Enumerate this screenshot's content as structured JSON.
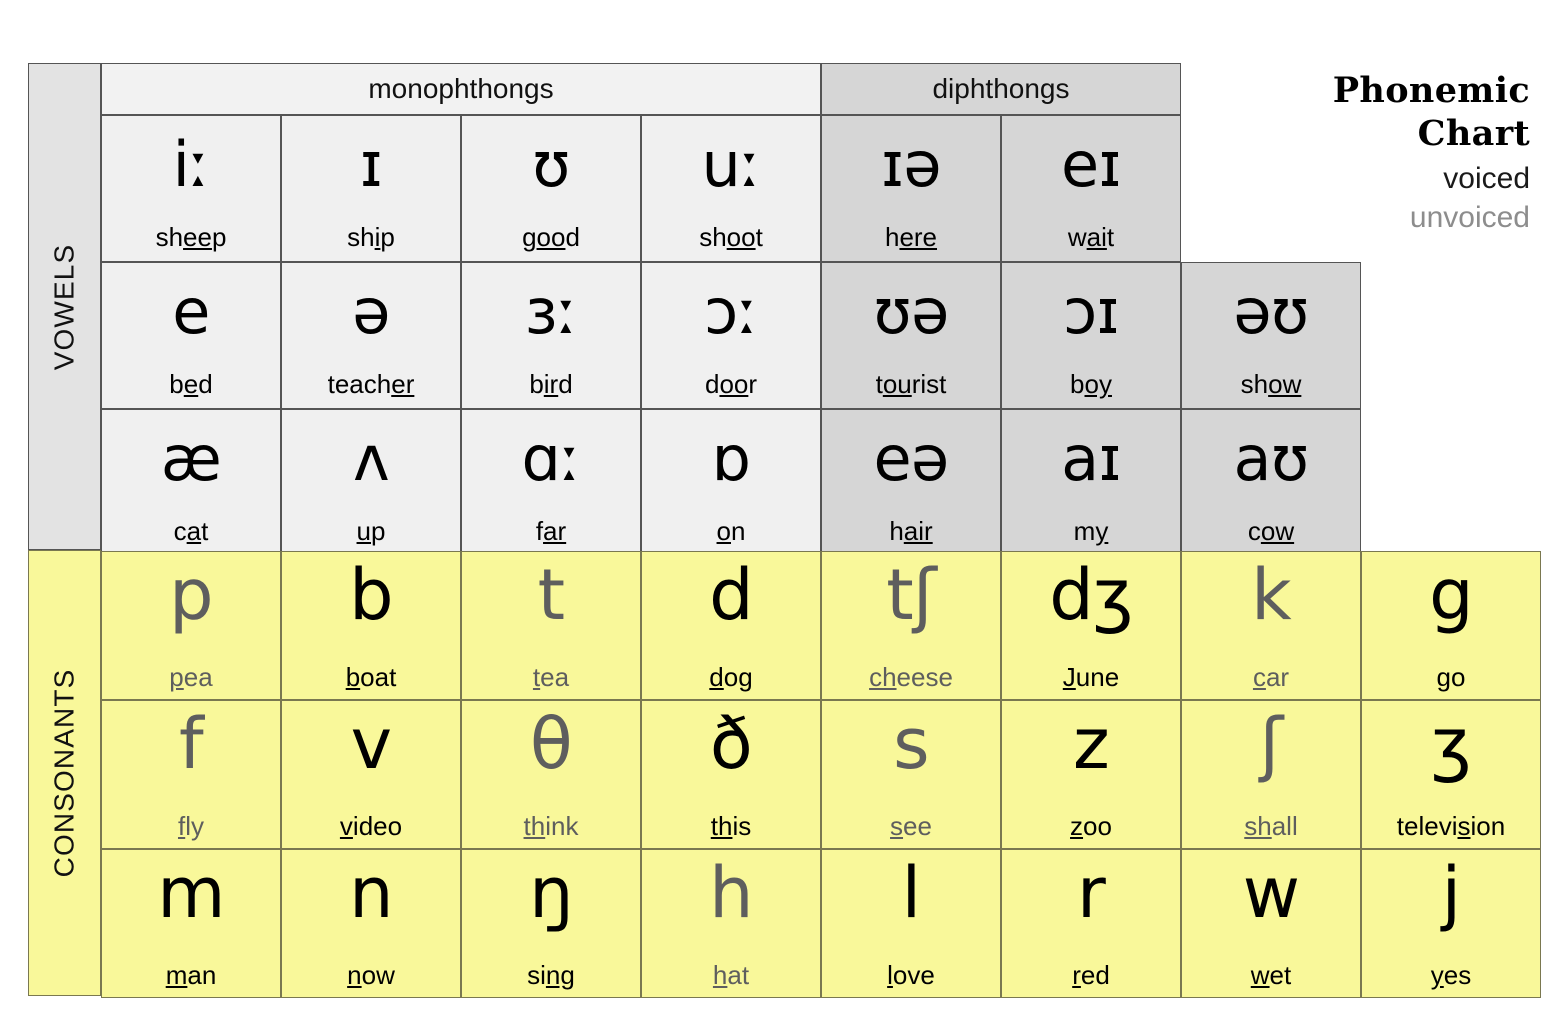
{
  "title": {
    "line1": "Phonemic",
    "line2": "Chart",
    "legend_voiced": "voiced",
    "legend_unvoiced": "unvoiced"
  },
  "side_labels": {
    "vowels": "VOWELS",
    "consonants": "CONSONANTS"
  },
  "headers": {
    "monophthongs": "monophthongs",
    "diphthongs": "diphthongs"
  },
  "vowels": {
    "monophthongs": [
      [
        {
          "symbol": "iː",
          "word_pre": "sh",
          "word_mid": "ee",
          "word_post": "p"
        },
        {
          "symbol": "ɪ",
          "word_pre": "sh",
          "word_mid": "i",
          "word_post": "p"
        },
        {
          "symbol": "ʊ",
          "word_pre": "g",
          "word_mid": "oo",
          "word_post": "d"
        },
        {
          "symbol": "uː",
          "word_pre": "sh",
          "word_mid": "oo",
          "word_post": "t"
        }
      ],
      [
        {
          "symbol": "e",
          "word_pre": "b",
          "word_mid": "e",
          "word_post": "d"
        },
        {
          "symbol": "ə",
          "word_pre": "teach",
          "word_mid": "er",
          "word_post": ""
        },
        {
          "symbol": "ɜː",
          "word_pre": "b",
          "word_mid": "ir",
          "word_post": "d"
        },
        {
          "symbol": "ɔː",
          "word_pre": "d",
          "word_mid": "oo",
          "word_post": "r"
        }
      ],
      [
        {
          "symbol": "æ",
          "word_pre": "c",
          "word_mid": "a",
          "word_post": "t"
        },
        {
          "symbol": "ʌ",
          "word_pre": "",
          "word_mid": "u",
          "word_post": "p"
        },
        {
          "symbol": "ɑː",
          "word_pre": "f",
          "word_mid": "ar",
          "word_post": ""
        },
        {
          "symbol": "ɒ",
          "word_pre": "",
          "word_mid": "o",
          "word_post": "n"
        }
      ]
    ],
    "diphthongs": [
      [
        {
          "symbol": "ɪə",
          "word_pre": "h",
          "word_mid": "ere",
          "word_post": ""
        },
        {
          "symbol": "eɪ",
          "word_pre": "w",
          "word_mid": "ai",
          "word_post": "t"
        }
      ],
      [
        {
          "symbol": "ʊə",
          "word_pre": "t",
          "word_mid": "ou",
          "word_post": "rist"
        },
        {
          "symbol": "ɔɪ",
          "word_pre": "b",
          "word_mid": "oy",
          "word_post": ""
        },
        {
          "symbol": "əʊ",
          "word_pre": "sh",
          "word_mid": "ow",
          "word_post": ""
        }
      ],
      [
        {
          "symbol": "eə",
          "word_pre": "h",
          "word_mid": "air",
          "word_post": ""
        },
        {
          "symbol": "aɪ",
          "word_pre": "m",
          "word_mid": "y",
          "word_post": ""
        },
        {
          "symbol": "aʊ",
          "word_pre": "c",
          "word_mid": "ow",
          "word_post": ""
        }
      ]
    ]
  },
  "consonants": [
    [
      {
        "symbol": "p",
        "voicing": "unvoiced",
        "word_pre": "",
        "word_mid": "p",
        "word_post": "ea"
      },
      {
        "symbol": "b",
        "voicing": "voiced",
        "word_pre": "",
        "word_mid": "b",
        "word_post": "oat"
      },
      {
        "symbol": "t",
        "voicing": "unvoiced",
        "word_pre": "",
        "word_mid": "t",
        "word_post": "ea"
      },
      {
        "symbol": "d",
        "voicing": "voiced",
        "word_pre": "",
        "word_mid": "d",
        "word_post": "og"
      },
      {
        "symbol": "tʃ",
        "voicing": "unvoiced",
        "word_pre": "",
        "word_mid": "ch",
        "word_post": "eese"
      },
      {
        "symbol": "dʒ",
        "voicing": "voiced",
        "word_pre": "",
        "word_mid": "J",
        "word_post": "une"
      },
      {
        "symbol": "k",
        "voicing": "unvoiced",
        "word_pre": "",
        "word_mid": "c",
        "word_post": "ar"
      },
      {
        "symbol": "g",
        "voicing": "voiced",
        "word_pre": "",
        "word_mid": "g",
        "word_post": "o"
      }
    ],
    [
      {
        "symbol": "f",
        "voicing": "unvoiced",
        "word_pre": "",
        "word_mid": "f",
        "word_post": "ly"
      },
      {
        "symbol": "v",
        "voicing": "voiced",
        "word_pre": "",
        "word_mid": "v",
        "word_post": "ideo"
      },
      {
        "symbol": "θ",
        "voicing": "unvoiced",
        "word_pre": "",
        "word_mid": "th",
        "word_post": "ink"
      },
      {
        "symbol": "ð",
        "voicing": "voiced",
        "word_pre": "",
        "word_mid": "th",
        "word_post": "is"
      },
      {
        "symbol": "s",
        "voicing": "unvoiced",
        "word_pre": "",
        "word_mid": "s",
        "word_post": "ee"
      },
      {
        "symbol": "z",
        "voicing": "voiced",
        "word_pre": "",
        "word_mid": "z",
        "word_post": "oo"
      },
      {
        "symbol": "ʃ",
        "voicing": "unvoiced",
        "word_pre": "",
        "word_mid": "sh",
        "word_post": "all"
      },
      {
        "symbol": "ʒ",
        "voicing": "voiced",
        "word_pre": "televi",
        "word_mid": "s",
        "word_post": "ion"
      }
    ],
    [
      {
        "symbol": "m",
        "voicing": "voiced",
        "word_pre": "",
        "word_mid": "m",
        "word_post": "an"
      },
      {
        "symbol": "n",
        "voicing": "voiced",
        "word_pre": "",
        "word_mid": "n",
        "word_post": "ow"
      },
      {
        "symbol": "ŋ",
        "voicing": "voiced",
        "word_pre": "si",
        "word_mid": "ng",
        "word_post": ""
      },
      {
        "symbol": "h",
        "voicing": "unvoiced",
        "word_pre": "",
        "word_mid": "h",
        "word_post": "at"
      },
      {
        "symbol": "l",
        "voicing": "voiced",
        "word_pre": "",
        "word_mid": "l",
        "word_post": "ove"
      },
      {
        "symbol": "r",
        "voicing": "voiced",
        "word_pre": "",
        "word_mid": "r",
        "word_post": "ed"
      },
      {
        "symbol": "w",
        "voicing": "voiced",
        "word_pre": "",
        "word_mid": "w",
        "word_post": "et"
      },
      {
        "symbol": "j",
        "voicing": "voiced",
        "word_pre": "",
        "word_mid": "y",
        "word_post": "es"
      }
    ]
  ],
  "colors": {
    "vowel_bg": "#f0f0f0",
    "diphthong_bg": "#d6d6d6",
    "consonant_bg": "#f9f89a",
    "side_label_bg": "#e3e3e3",
    "voiced_text": "#000000",
    "unvoiced_text": "#5e5e5e"
  }
}
